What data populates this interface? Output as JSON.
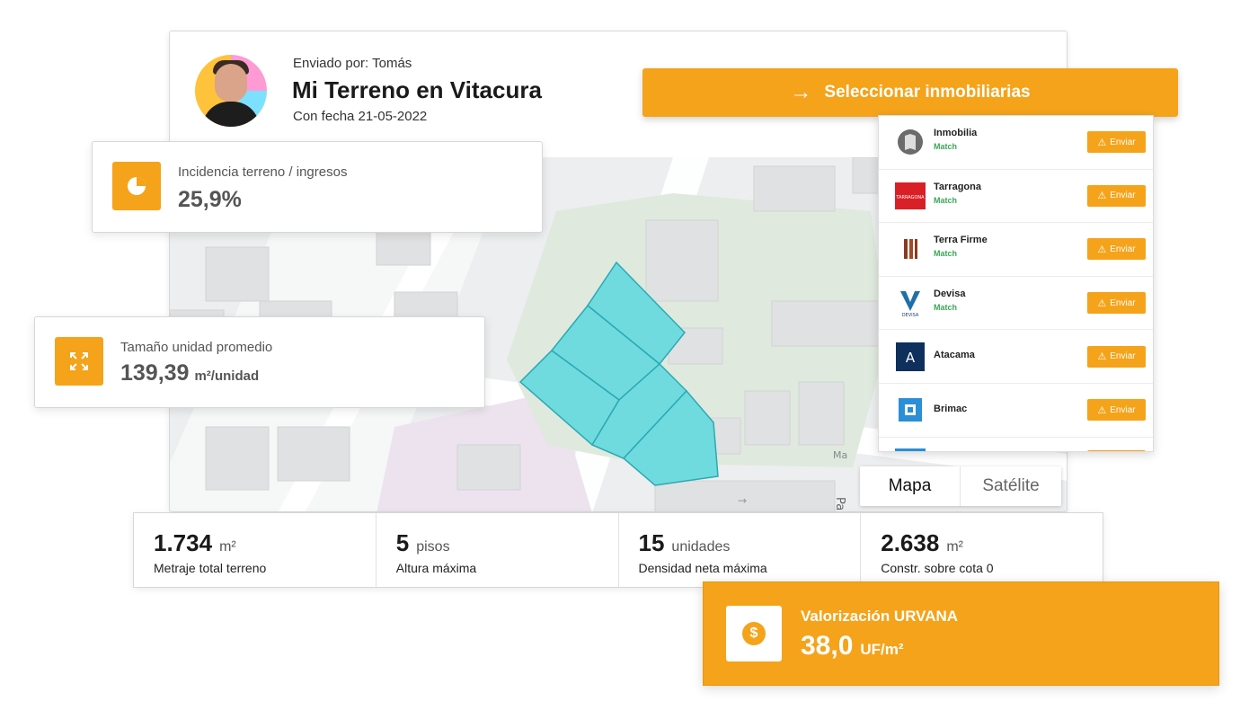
{
  "header": {
    "sent_by": "Enviado por: Tomás",
    "title": "Mi Terreno en Vitacura",
    "date": "Con fecha 21-05-2022"
  },
  "select_button": {
    "label": "Seleccionar inmobiliarias",
    "icon": "arrow-right-icon"
  },
  "inmobiliarias": [
    {
      "name": "Inmobilia",
      "status": "Match",
      "action": "Enviar",
      "logo_color": "#5a5a5a"
    },
    {
      "name": "Tarragona",
      "status": "Match",
      "action": "Enviar",
      "logo_color": "#d92027",
      "logo_text": "TARRAGONA"
    },
    {
      "name": "Terra Firme",
      "status": "Match",
      "action": "Enviar",
      "logo_color": "#8a3b1f"
    },
    {
      "name": "Devisa",
      "status": "Match",
      "action": "Enviar",
      "logo_color": "#1f6fa8",
      "logo_text": "DEVISA"
    },
    {
      "name": "Atacama",
      "status": "",
      "action": "Enviar",
      "logo_color": "#0f2f5c",
      "logo_text": "A"
    },
    {
      "name": "Brimac",
      "status": "",
      "action": "Enviar",
      "logo_color": "#2a8fd6"
    }
  ],
  "incidencia": {
    "label": "Incidencia terreno / ingresos",
    "value": "25,9%",
    "icon": "pie-chart-icon"
  },
  "tamano": {
    "label": "Tamaño unidad promedio",
    "value": "139,39",
    "unit": "m²/unidad",
    "icon": "expand-icon"
  },
  "map_toggle": {
    "map": "Mapa",
    "satellite": "Satélite",
    "active": "Mapa"
  },
  "map_labels": {
    "street_1": "Pa",
    "street_2": "Ma"
  },
  "metrics": [
    {
      "value": "1.734",
      "unit": "m²",
      "label": "Metraje total terreno"
    },
    {
      "value": "5",
      "unit": "pisos",
      "label": "Altura máxima"
    },
    {
      "value": "15",
      "unit": "unidades",
      "label": "Densidad neta máxima"
    },
    {
      "value": "2.638",
      "unit": "m²",
      "label": "Constr. sobre cota 0"
    }
  ],
  "valorizacion": {
    "label": "Valorización URVANA",
    "value": "38,0",
    "unit": "UF/m²",
    "icon": "dollar-coin-icon"
  },
  "colors": {
    "accent": "#f5a31a",
    "match": "#3aa757",
    "parcel": "#6fdbdf",
    "park": "#dfe9de"
  }
}
